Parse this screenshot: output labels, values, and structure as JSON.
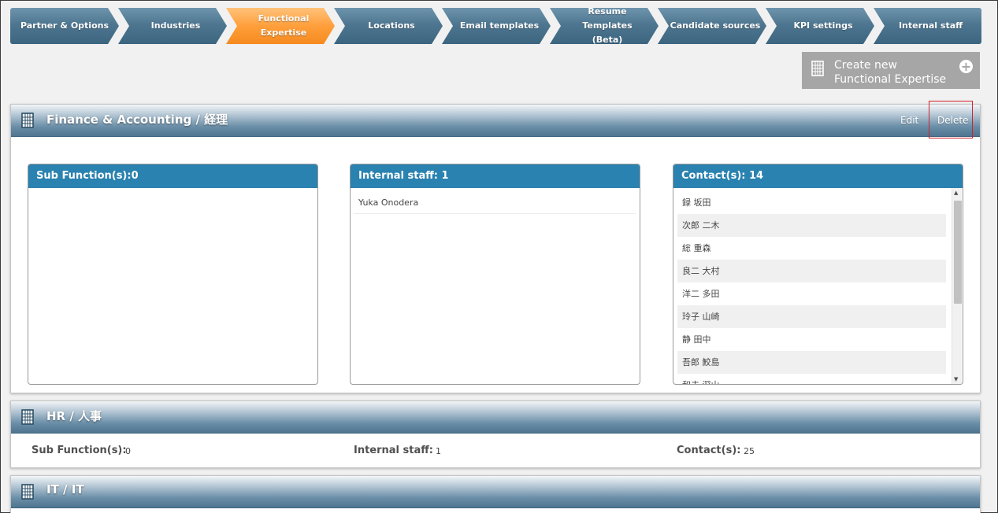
{
  "steps": [
    {
      "label": "Partner & Options",
      "active": false
    },
    {
      "label": "Industries",
      "active": false
    },
    {
      "label": "Functional Expertise",
      "active": true
    },
    {
      "label": "Locations",
      "active": false
    },
    {
      "label": "Email templates",
      "active": false
    },
    {
      "label": "Resume Templates (Beta)",
      "active": false
    },
    {
      "label": "Candidate sources",
      "active": false
    },
    {
      "label": "KPI settings",
      "active": false
    },
    {
      "label": "Internal staff",
      "active": false
    }
  ],
  "create_button": {
    "line1": "Create new",
    "line2": "Functional Expertise",
    "icon": "plus-circle-icon"
  },
  "panels": [
    {
      "title": "Finance & Accounting / 経理",
      "icon": "building-icon",
      "edit_label": "Edit",
      "delete_label": "Delete",
      "sub_functions": {
        "header": "Sub Function(s):0"
      },
      "internal_staff": {
        "header": "Internal staff: 1",
        "items": [
          "Yuka Onodera"
        ]
      },
      "contacts": {
        "header": "Contact(s): 14",
        "items": [
          "録 坂田",
          "次郎 二木",
          "総 重森",
          "良二 大村",
          "洋二 多田",
          "玲子 山崎",
          "静 田中",
          "吾郎 鮫島",
          "和夫 深山"
        ]
      }
    },
    {
      "title": "HR / 人事",
      "icon": "building-icon",
      "sub_functions_label": "Sub Function(s):",
      "sub_functions_value": "0",
      "internal_staff_label": "Internal staff:",
      "internal_staff_value": "1",
      "contacts_label": "Contact(s):",
      "contacts_value": "25"
    },
    {
      "title": "IT / IT",
      "icon": "building-icon"
    }
  ],
  "colors": {
    "active_tab": "#ff9f3b",
    "tab": "#4e7690",
    "box_header": "#2a82b0",
    "create_button": "#a6a6a6",
    "highlight": "#d0202a"
  }
}
